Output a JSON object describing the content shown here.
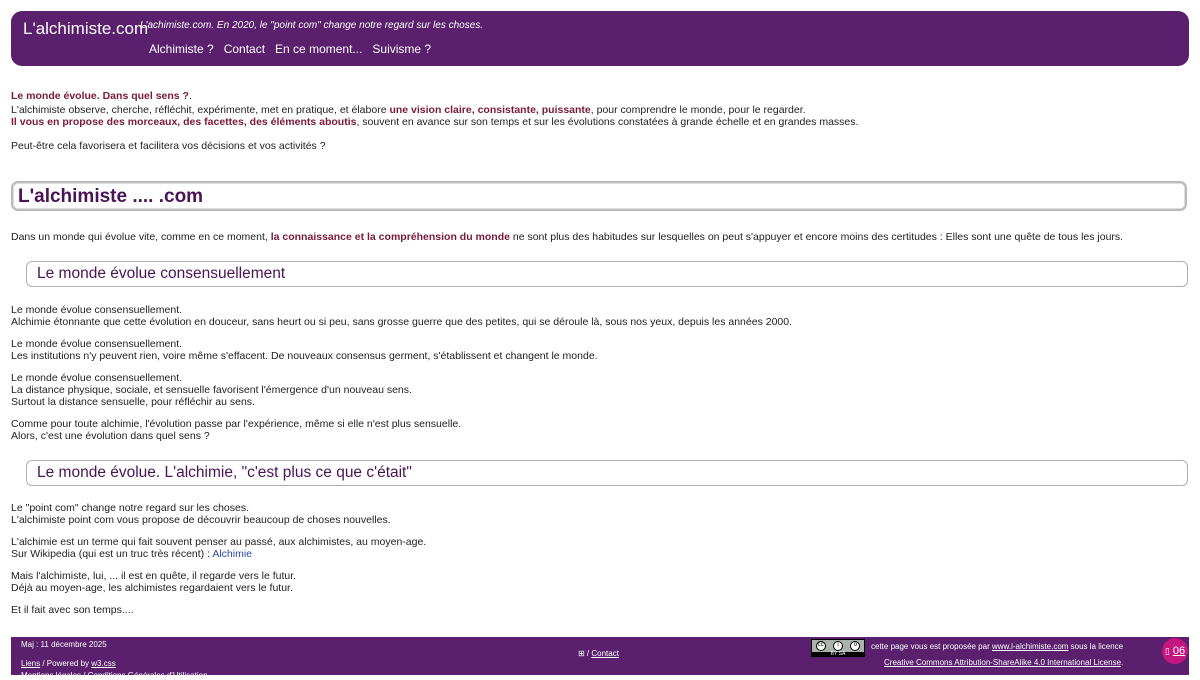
{
  "header": {
    "site_title": "L'alchimiste.com",
    "tagline": "L'achimiste.com. En 2020, le \"point com\" change notre regard sur les choses.",
    "nav": [
      "Alchimiste ?",
      "Contact",
      "En ce moment...",
      "Suivisme ?"
    ]
  },
  "intro": {
    "line1_strong": "Le monde évolue. Dans quel sens ?",
    "line1_tail": ".",
    "line2_a": "L'alchimiste observe, cherche, réfléchit, expérimente, met en pratique, et élabore ",
    "line2_strong": "une vision claire, consistante, puissante",
    "line2_b": ", pour comprendre le monde, pour le regarder.",
    "line3_strong": "Il vous en propose des morceaux, des facettes, des éléments aboutis",
    "line3_b": ", souvent en avance sur son temps et sur les évolutions constatées à grande échelle et en grandes masses.",
    "line4": "Peut-être cela favorisera et facilitera vos décisions et vos activités ?"
  },
  "section_main": {
    "title": "L'alchimiste .... .com",
    "para_a": "Dans un monde qui évolue vite, comme en ce moment, ",
    "para_strong": "la connaissance et la compréhension du monde",
    "para_b": " ne sont plus des habitudes sur lesquelles on peut s'appuyer et encore moins des certitudes : Elles sont une quête de tous les jours."
  },
  "section1": {
    "title": "Le monde évolue consensuellement",
    "p1": [
      "Le monde évolue consensuellement.",
      "Alchimie étonnante que cette évolution en douceur, sans heurt ou si peu, sans grosse guerre que des petites, qui se déroule là, sous nos yeux, depuis les années 2000."
    ],
    "p2": [
      "Le monde évolue consensuellement.",
      "Les institutions n'y peuvent rien, voire même s'effacent. De nouveaux consensus germent, s'établissent et changent le monde."
    ],
    "p3": [
      "Le monde évolue consensuellement.",
      "La distance physique, sociale, et sensuelle favorisent l'émergence d'un nouveau sens.",
      "Surtout la distance sensuelle, pour réfléchir au sens."
    ],
    "p4": [
      "Comme pour toute alchimie, l'évolution passe par l'expérience, même si elle n'est plus sensuelle.",
      "Alors, c'est une évolution dans quel sens ?"
    ]
  },
  "section2": {
    "title": "Le monde évolue. L'alchimie, \"c'est plus ce que c'était\"",
    "p1": [
      "Le \"point com\" change notre regard sur les choses.",
      "L'alchimiste point com vous propose de découvrir beaucoup de choses nouvelles."
    ],
    "p2_line1": "L'alchimie est un terme qui fait souvent penser au passé, aux alchimistes, au moyen-age.",
    "p2_line2_a": "Sur Wikipedia (qui est un truc très récent) : ",
    "p2_link": "Alchimie",
    "p3": [
      "Mais l'alchimiste, lui, ... il est en quête, il regarde vers le futur.",
      "Déjà au moyen-age, les alchimistes regardaient vers le futur."
    ],
    "p4": "Et il fait avec son temps...."
  },
  "footer": {
    "maj": "Maj : 11 décembre 2025",
    "liens": "Liens",
    "powered_by": " / Powered by ",
    "w3css": "w3.css",
    "mentions": "Mentions légales / Conditions Générales d'Utilisation",
    "contact_prefix": "⊞ / ",
    "contact": "Contact",
    "license_a": "cette page vous est proposée par ",
    "license_site": "www.l-alchimiste.com",
    "license_b": " sous la licence",
    "license_link": "Creative Commons Attribution-ShareAlike 4.0 International License",
    "license_end": ".",
    "cc_badge_text": "BY SA",
    "badge": "06"
  }
}
